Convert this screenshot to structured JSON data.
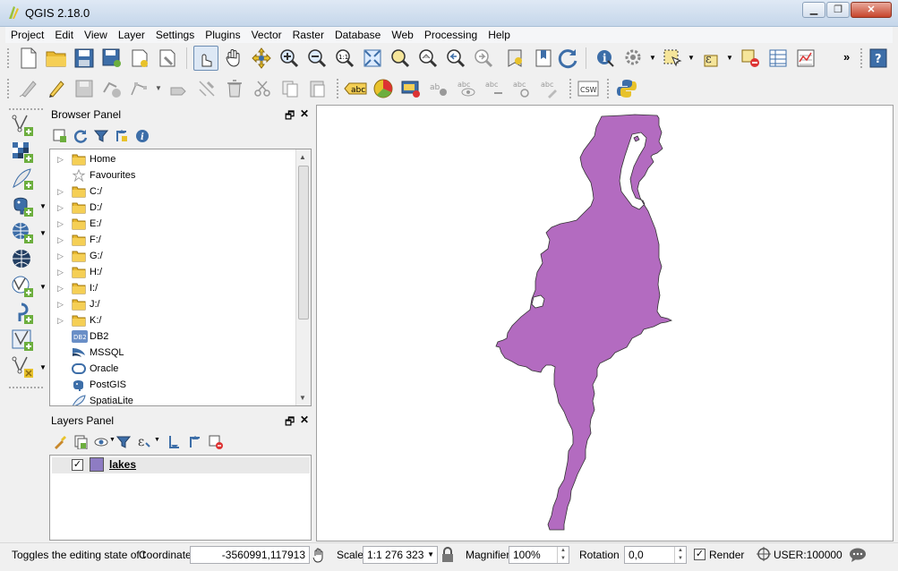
{
  "window": {
    "title": "QGIS 2.18.0"
  },
  "menu": [
    "Project",
    "Edit",
    "View",
    "Layer",
    "Settings",
    "Plugins",
    "Vector",
    "Raster",
    "Database",
    "Web",
    "Processing",
    "Help"
  ],
  "toolbar2": {
    "csw_label": "CSW",
    "abc_label": "abc"
  },
  "browser_panel": {
    "title": "Browser Panel",
    "items": [
      {
        "label": "Home",
        "icon": "folder-icon",
        "expandable": true
      },
      {
        "label": "Favourites",
        "icon": "star-icon",
        "expandable": false
      },
      {
        "label": "C:/",
        "icon": "folder-icon",
        "expandable": true
      },
      {
        "label": "D:/",
        "icon": "folder-icon",
        "expandable": true
      },
      {
        "label": "E:/",
        "icon": "folder-icon",
        "expandable": true
      },
      {
        "label": "F:/",
        "icon": "folder-icon",
        "expandable": true
      },
      {
        "label": "G:/",
        "icon": "folder-icon",
        "expandable": true
      },
      {
        "label": "H:/",
        "icon": "folder-icon",
        "expandable": true
      },
      {
        "label": "I:/",
        "icon": "folder-icon",
        "expandable": true
      },
      {
        "label": "J:/",
        "icon": "folder-icon",
        "expandable": true
      },
      {
        "label": "K:/",
        "icon": "folder-icon",
        "expandable": true
      },
      {
        "label": "DB2",
        "icon": "db2-icon",
        "expandable": false,
        "badge": "DB2"
      },
      {
        "label": "MSSQL",
        "icon": "mssql-icon",
        "expandable": false
      },
      {
        "label": "Oracle",
        "icon": "oracle-icon",
        "expandable": false
      },
      {
        "label": "PostGIS",
        "icon": "postgis-elephant-icon",
        "expandable": false
      },
      {
        "label": "SpatiaLite",
        "icon": "spatialite-feather-icon",
        "expandable": false
      }
    ]
  },
  "layers_panel": {
    "title": "Layers Panel",
    "layers": [
      {
        "name": "lakes",
        "visible": true,
        "color": "#8e7cc3"
      }
    ]
  },
  "map": {
    "fill_color": "#b36bc0",
    "stroke_color": "#333333"
  },
  "statusbar": {
    "message": "Toggles the editing state of t",
    "coordinate_label": "Coordinate",
    "coordinate_value": "-3560991,117913",
    "scale_label": "Scale",
    "scale_value": "1:1 276 323",
    "magnifier_label": "Magnifier",
    "magnifier_value": "100%",
    "rotation_label": "Rotation",
    "rotation_value": "0,0",
    "render_label": "Render",
    "render_checked": true,
    "crs_label": "USER:100000"
  },
  "colors": {
    "accent": "#6c8db3",
    "titlebar": "#c5d6ea",
    "layer_swatch": "#8e7cc3"
  }
}
